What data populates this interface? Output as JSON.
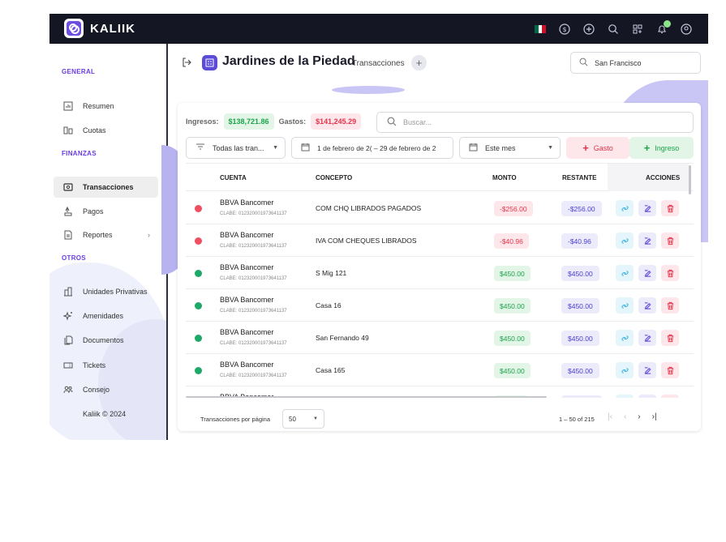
{
  "app": {
    "brand": "KALIIK",
    "copyright": "Kaliik © 2024"
  },
  "topbar": {
    "icons": [
      "mexico-flag-icon",
      "currency-icon",
      "add-circle-icon",
      "search-icon",
      "apps-icon",
      "bell-icon",
      "user-icon"
    ],
    "flag_colors": [
      "#006847",
      "#ffffff",
      "#ce1126"
    ]
  },
  "sidebar": {
    "sections": [
      {
        "title": "GENERAL",
        "items": [
          {
            "label": "Resumen",
            "icon": "chart-icon"
          },
          {
            "label": "Cuotas",
            "icon": "cuotas-icon"
          }
        ]
      },
      {
        "title": "FINANZAS",
        "items": [
          {
            "label": "Transacciones",
            "icon": "transactions-icon",
            "active": true
          },
          {
            "label": "Pagos",
            "icon": "hand-coin-icon"
          },
          {
            "label": "Reportes",
            "icon": "report-icon",
            "chevron": "›"
          }
        ]
      },
      {
        "title": "OTROS",
        "items": [
          {
            "label": "Unidades Privativas",
            "icon": "building-icon"
          },
          {
            "label": "Amenidades",
            "icon": "sparkle-icon"
          },
          {
            "label": "Documentos",
            "icon": "documents-icon"
          },
          {
            "label": "Tickets",
            "icon": "ticket-icon"
          },
          {
            "label": "Consejo",
            "icon": "group-icon"
          }
        ]
      }
    ]
  },
  "header": {
    "title": "Jardines de la Piedad",
    "subtitle": "- Transacciones",
    "search_value": "San Francisco"
  },
  "summary": {
    "ingresos_label": "Ingresos:",
    "ingresos_value": "$138,721.86",
    "gastos_label": "Gastos:",
    "gastos_value": "$141,245.29",
    "search_placeholder": "Buscar..."
  },
  "filters": {
    "type": "Todas las tran...",
    "date_range": "1 de febrero de 2( – 29 de febrero de 2",
    "period": "Este mes",
    "gasto_label": "Gasto",
    "ingreso_label": "Ingreso"
  },
  "table": {
    "columns": {
      "cuenta": "CUENTA",
      "concepto": "CONCEPTO",
      "monto": "MONTO",
      "restante": "RESTANTE",
      "acciones": "ACCIONES"
    },
    "rows": [
      {
        "status": "red",
        "bank": "BBVA Bancomer",
        "clabe": "CLABE: 012320001973641137",
        "concept": "COM CHQ LIBRADOS PAGADOS",
        "monto": "-$256.00",
        "restante": "-$256.00",
        "type": "neg"
      },
      {
        "status": "red",
        "bank": "BBVA Bancomer",
        "clabe": "CLABE: 012320001973641137",
        "concept": "IVA COM CHEQUES LIBRADOS",
        "monto": "-$40.96",
        "restante": "-$40.96",
        "type": "neg"
      },
      {
        "status": "green",
        "bank": "BBVA Bancomer",
        "clabe": "CLABE: 012320001973641137",
        "concept": "S Mig 121",
        "monto": "$450.00",
        "restante": "$450.00",
        "type": "pos"
      },
      {
        "status": "green",
        "bank": "BBVA Bancomer",
        "clabe": "CLABE: 012320001973641137",
        "concept": "Casa 16",
        "monto": "$450.00",
        "restante": "$450.00",
        "type": "pos"
      },
      {
        "status": "green",
        "bank": "BBVA Bancomer",
        "clabe": "CLABE: 012320001973641137",
        "concept": "San Fernando 49",
        "monto": "$450.00",
        "restante": "$450.00",
        "type": "pos"
      },
      {
        "status": "green",
        "bank": "BBVA Bancomer",
        "clabe": "CLABE: 012320001973641137",
        "concept": "Casa 165",
        "monto": "$450.00",
        "restante": "$450.00",
        "type": "pos"
      },
      {
        "status": "green",
        "bank": "BBVA Bancomer",
        "clabe": "",
        "concept": "",
        "monto": "",
        "restante": "",
        "type": "pos"
      }
    ]
  },
  "pagination": {
    "per_page_label": "Transacciones por página",
    "per_page_value": "50",
    "range": "1 – 50 of 215"
  },
  "colors": {
    "accent": "#6a3de0",
    "topbar": "#141624",
    "red": "#e5334b",
    "green": "#1aa54b",
    "status_red": "#ef4f5f",
    "status_green": "#1fa968"
  }
}
